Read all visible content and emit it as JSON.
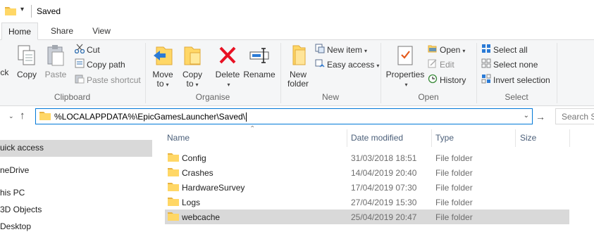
{
  "window": {
    "title": "Saved",
    "quick_access_dropdown": "▾",
    "clipped_text": "...................................."
  },
  "tabs": [
    {
      "label": "Home",
      "active": true
    },
    {
      "label": "Share",
      "active": false
    },
    {
      "label": "View",
      "active": false
    }
  ],
  "ribbon": {
    "clipboard": {
      "label": "Clipboard",
      "pin_partial": "ick",
      "copy": "Copy",
      "paste": "Paste",
      "cut": "Cut",
      "copy_path": "Copy path",
      "paste_shortcut": "Paste shortcut"
    },
    "organise": {
      "label": "Organise",
      "move_to_line1": "Move",
      "move_to_line2": "to",
      "copy_to_line1": "Copy",
      "copy_to_line2": "to",
      "delete": "Delete",
      "rename": "Rename",
      "arrow": "▾"
    },
    "new": {
      "label": "New",
      "new_folder_line1": "New",
      "new_folder_line2": "folder",
      "new_item": "New item",
      "easy_access": "Easy access"
    },
    "open": {
      "label": "Open",
      "properties": "Properties",
      "open": "Open",
      "edit": "Edit",
      "history": "History"
    },
    "select": {
      "label": "Select",
      "select_all": "Select all",
      "select_none": "Select none",
      "invert_selection": "Invert selection"
    }
  },
  "address": {
    "path": "%LOCALAPPDATA%\\EpicGamesLauncher\\Saved\\",
    "search_placeholder": "Search Saved"
  },
  "nav_pane": {
    "items": [
      {
        "label": "uick access",
        "selected": true
      },
      {
        "label": "neDrive",
        "selected": false
      },
      {
        "label": "his PC",
        "selected": false
      },
      {
        "label": "3D Objects",
        "selected": false
      },
      {
        "label": "Desktop",
        "selected": false
      }
    ]
  },
  "file_list": {
    "columns": {
      "name": "Name",
      "date_modified": "Date modified",
      "type": "Type",
      "size": "Size"
    },
    "rows": [
      {
        "name": "Config",
        "date": "31/03/2018 18:51",
        "type": "File folder",
        "selected": false
      },
      {
        "name": "Crashes",
        "date": "14/04/2019 20:40",
        "type": "File folder",
        "selected": false
      },
      {
        "name": "HardwareSurvey",
        "date": "17/04/2019 07:30",
        "type": "File folder",
        "selected": false
      },
      {
        "name": "Logs",
        "date": "27/04/2019 15:30",
        "type": "File folder",
        "selected": false
      },
      {
        "name": "webcache",
        "date": "25/04/2019 20:47",
        "type": "File folder",
        "selected": true
      }
    ]
  },
  "colors": {
    "accent": "#0078d7",
    "folder": "#ffd766",
    "folder_dark": "#e8b343",
    "ribbon_bg": "#f5f6f7",
    "selection": "#d9d9d9",
    "delete_red": "#e81123"
  }
}
